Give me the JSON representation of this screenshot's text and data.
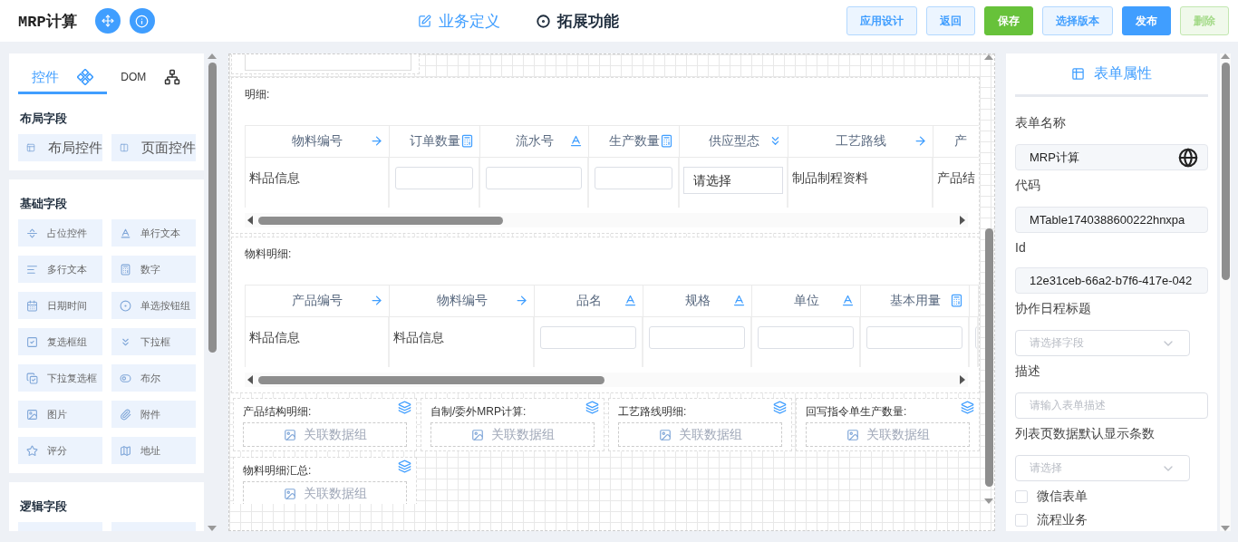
{
  "header": {
    "title": "MRP计算",
    "tabs": [
      {
        "label": "业务定义",
        "selected": false
      },
      {
        "label": "拓展功能",
        "selected": true
      }
    ],
    "buttons": [
      {
        "label": "应用设计",
        "kind": "default",
        "disabled": false
      },
      {
        "label": "返回",
        "kind": "default",
        "disabled": false
      },
      {
        "label": "保存",
        "kind": "success",
        "disabled": false
      },
      {
        "label": "选择版本",
        "kind": "default",
        "disabled": false
      },
      {
        "label": "发布",
        "kind": "primary",
        "disabled": false
      },
      {
        "label": "删除",
        "kind": "success",
        "disabled": true
      }
    ]
  },
  "sidebar": {
    "tabs": [
      {
        "label": "控件",
        "selected": true
      },
      {
        "label": "DOM",
        "selected": false
      }
    ],
    "sections": [
      {
        "title": "布局字段",
        "kind": "large",
        "items": [
          "布局控件",
          "页面控件"
        ]
      },
      {
        "title": "基础字段",
        "kind": "small",
        "items": [
          "占位控件",
          "单行文本",
          "多行文本",
          "数字",
          "日期时间",
          "单选按钮组",
          "复选框组",
          "下拉框",
          "下拉复选框",
          "布尔",
          "图片",
          "附件",
          "评分",
          "地址"
        ]
      },
      {
        "title": "逻辑字段",
        "kind": "cut"
      }
    ]
  },
  "canvas": {
    "tables": [
      {
        "label": "明细:",
        "columns": [
          {
            "title": "物料编号",
            "kind": "lookup"
          },
          {
            "title": "订单数量",
            "kind": "number"
          },
          {
            "title": "流水号",
            "kind": "text"
          },
          {
            "title": "生产数量",
            "kind": "number"
          },
          {
            "title": "供应型态",
            "kind": "select"
          },
          {
            "title": "工艺路线",
            "kind": "lookup"
          },
          {
            "title": "产",
            "kind": "cut"
          }
        ],
        "row": [
          {
            "kind": "text",
            "text": "料品信息"
          },
          {
            "kind": "input"
          },
          {
            "kind": "input"
          },
          {
            "kind": "input"
          },
          {
            "kind": "select",
            "text": "请选择"
          },
          {
            "kind": "text",
            "text": "制品制程资料"
          },
          {
            "kind": "text",
            "text": "产品结"
          }
        ]
      },
      {
        "label": "物料明细:",
        "columns": [
          {
            "title": "产品编号",
            "kind": "lookup"
          },
          {
            "title": "物料编号",
            "kind": "lookup"
          },
          {
            "title": "品名",
            "kind": "text"
          },
          {
            "title": "规格",
            "kind": "text"
          },
          {
            "title": "单位",
            "kind": "text"
          },
          {
            "title": "基本用量",
            "kind": "number"
          }
        ],
        "row": [
          {
            "kind": "text",
            "text": "料品信息"
          },
          {
            "kind": "text",
            "text": "料品信息"
          },
          {
            "kind": "input"
          },
          {
            "kind": "input"
          },
          {
            "kind": "input"
          },
          {
            "kind": "input"
          }
        ]
      }
    ],
    "subforms": [
      {
        "title": "产品结构明细:",
        "placeholder": "关联数据组"
      },
      {
        "title": "自制/委外MRP计算:",
        "placeholder": "关联数据组"
      },
      {
        "title": "工艺路线明细:",
        "placeholder": "关联数据组"
      },
      {
        "title": "回写指令单生产数量:",
        "placeholder": "关联数据组"
      },
      {
        "title": "物料明细汇总:",
        "placeholder": "关联数据组"
      }
    ]
  },
  "properties": {
    "title": "表单属性",
    "fields": [
      {
        "label": "表单名称",
        "kind": "input",
        "value": "MRP计算",
        "globe": true
      },
      {
        "label": "代码",
        "kind": "input",
        "value": "MTable1740388600222hnxpa",
        "globe": false
      },
      {
        "label": "Id",
        "kind": "input",
        "value": "12e31ceb-66a2-b7f6-417e-042",
        "globe": false
      },
      {
        "label": "协作日程标题",
        "kind": "select",
        "placeholder": "请选择字段"
      },
      {
        "label": "描述",
        "kind": "input",
        "placeholder": "请输入表单描述"
      },
      {
        "label": "列表页数据默认显示条数",
        "kind": "select",
        "placeholder": "请选择"
      }
    ],
    "checkboxes": [
      {
        "label": "微信表单",
        "checked": false
      },
      {
        "label": "流程业务",
        "checked": false
      }
    ]
  }
}
